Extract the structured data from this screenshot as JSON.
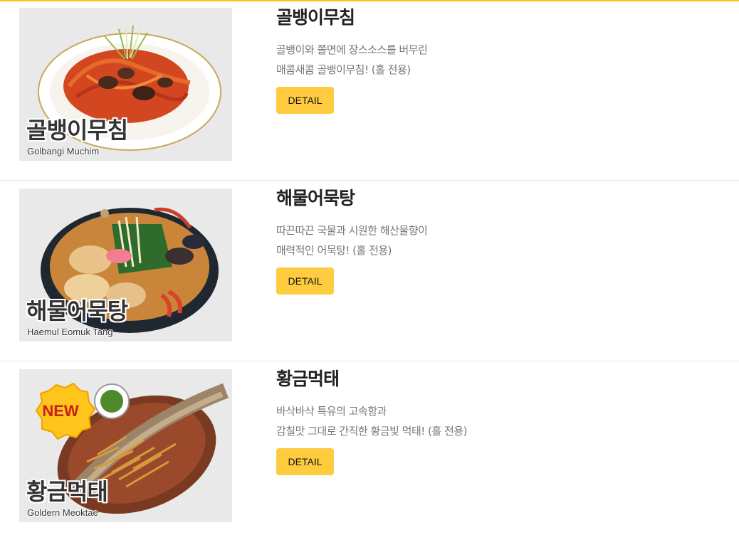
{
  "menu": {
    "items": [
      {
        "title": "골뱅이무침",
        "desc_line1": "골뱅이와 쫄면에 장스소스를 버무린",
        "desc_line2": "매콤새콤 골뱅이무침! (홀 전용)",
        "thumb_ko": "골뱅이무침",
        "thumb_en": "Golbangi Muchim",
        "button_label": "DETAIL"
      },
      {
        "title": "해물어묵탕",
        "desc_line1": "따끈따끈 국물과 시원한 해산물향이",
        "desc_line2": "매력적인 어묵탕! (홀 전용)",
        "thumb_ko": "해물어묵탕",
        "thumb_en": "Haemul Eomuk Tang",
        "button_label": "DETAIL"
      },
      {
        "title": "황금먹태",
        "desc_line1": "바삭바삭 특유의 고속함과",
        "desc_line2": "감칠맛 그대로 간직한 황금빛 먹태! (홀 전용)",
        "thumb_ko": "황금먹태",
        "thumb_en": "Goldern Meoktae",
        "badge": "NEW",
        "button_label": "DETAIL"
      }
    ]
  },
  "colors": {
    "accent": "#ffcc3f",
    "top_border": "#f5c518",
    "title": "#222222",
    "desc": "#777777",
    "divider": "#e6e6e6"
  }
}
